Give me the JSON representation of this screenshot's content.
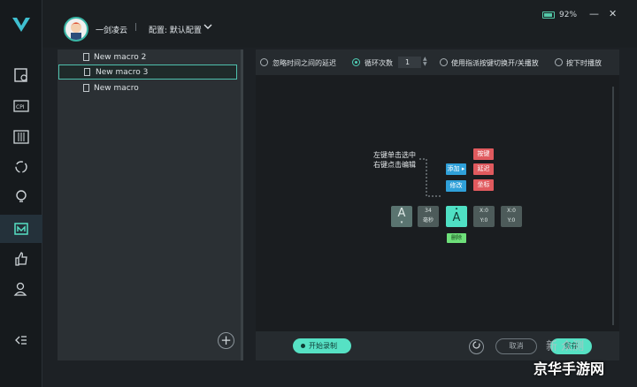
{
  "header": {
    "user_name": "一剑凌云",
    "separator": "|",
    "config_label": "配置: 默认配置",
    "battery": "92%",
    "minimize": "—",
    "close": "✕"
  },
  "nav": {
    "items": [
      "monitor-settings",
      "cpi",
      "equalizer",
      "sync",
      "lighting",
      "macro",
      "like",
      "account"
    ],
    "active": "macro",
    "collapse": "collapse"
  },
  "macro_list": {
    "items": [
      {
        "label": "New macro 2",
        "selected": false
      },
      {
        "label": "New macro 3",
        "selected": true
      },
      {
        "label": "New macro",
        "selected": false
      }
    ],
    "add_label": "+"
  },
  "options": {
    "ignore_delay": "忽略时间之间的延迟",
    "loop_count": "循环次数",
    "loop_value": "1",
    "toggle_key": "使用指派按键切换开/关播放",
    "hold_play": "按下时播放"
  },
  "editor": {
    "hint_line1": "左键单击选中",
    "hint_line2": "右键点击编辑",
    "add_chip": "添加 ▸",
    "modify_chip": "修改",
    "red_chips": [
      "按键",
      "延迟",
      "坐标"
    ],
    "key_a1": "A",
    "key_a1_arrow": "▾",
    "delay_value": "34",
    "delay_unit": "毫秒",
    "key_a2": "A",
    "key_a2_arrow": "▴",
    "delete_chip": "删除",
    "coord1_x": "X:0",
    "coord1_y": "Y:0",
    "coord2_x": "X:0",
    "coord2_y": "Y:0"
  },
  "bottom": {
    "record": "开始录制",
    "cancel": "取消",
    "save": "保存"
  },
  "watermark": {
    "main": "京华手游网",
    "sub": "新 众测"
  },
  "colors": {
    "accent": "#56e1c4",
    "red": "#e05a5e",
    "blue": "#2fa0d9",
    "green": "#6ee07a"
  }
}
